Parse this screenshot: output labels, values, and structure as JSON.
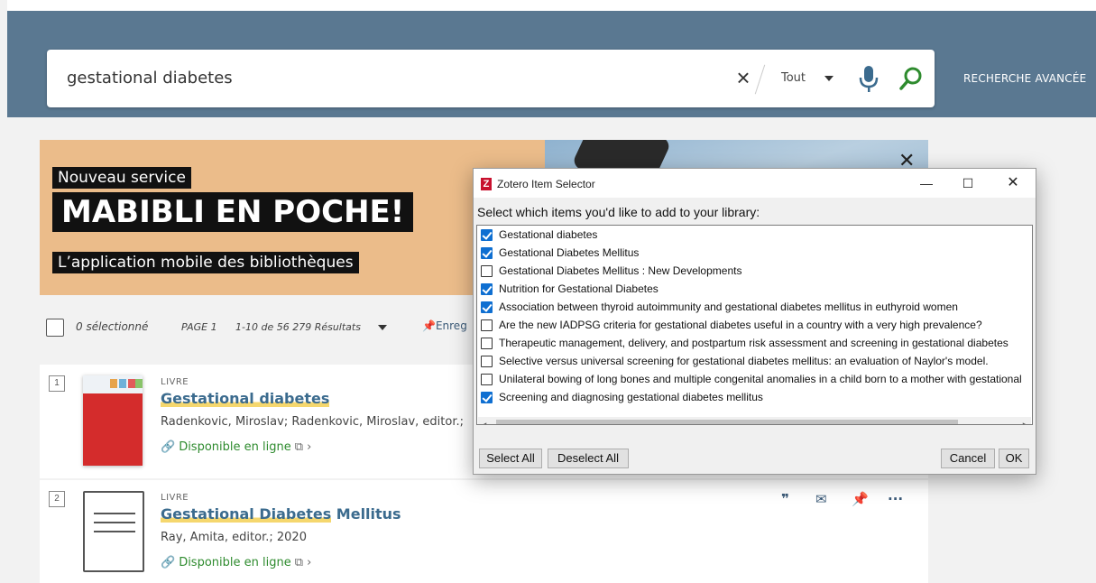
{
  "search": {
    "query": "gestational diabetes",
    "scope": "Tout",
    "advanced_label": "RECHERCHE AVANCÉE"
  },
  "promo": {
    "tag": "Nouveau service",
    "title": "MABIBLI EN POCHE!",
    "subtitle": "L’application mobile des bibliothèques"
  },
  "toolbar": {
    "selected": "0 sélectionné",
    "page": "PAGE 1",
    "count": "1-10 de 56 279 Résultats",
    "save_label": "Enreg"
  },
  "results": [
    {
      "number": "1",
      "type": "LIVRE",
      "title_highlight": "Gestational diabetes",
      "title_rest": "",
      "author": "Radenkovic, Miroslav; Radenkovic, Miroslav, editor.;",
      "availability": "Disponible en ligne"
    },
    {
      "number": "2",
      "type": "LIVRE",
      "title_highlight": "Gestational Diabetes",
      "title_rest": " Mellitus",
      "author": "Ray, Amita, editor.; 2020",
      "availability": "Disponible en ligne"
    }
  ],
  "dialog": {
    "title": "Zotero Item Selector",
    "logo_letter": "Z",
    "prompt": "Select which items you'd like to add to your library:",
    "items": [
      {
        "label": "Gestational diabetes",
        "checked": true
      },
      {
        "label": "Gestational Diabetes Mellitus",
        "checked": true
      },
      {
        "label": "Gestational Diabetes Mellitus : New Developments",
        "checked": false
      },
      {
        "label": "Nutrition for Gestational Diabetes",
        "checked": true
      },
      {
        "label": "Association between thyroid autoimmunity and gestational diabetes mellitus in euthyroid women",
        "checked": true
      },
      {
        "label": "Are the new IADPSG criteria for gestational diabetes useful in a country with a very high prevalence?",
        "checked": false
      },
      {
        "label": "Therapeutic management, delivery, and postpartum risk assessment and screening in gestational diabetes",
        "checked": false
      },
      {
        "label": "Selective versus universal screening for gestational diabetes mellitus: an evaluation of Naylor's model.",
        "checked": false
      },
      {
        "label": "Unilateral bowing of long bones and multiple congenital anomalies in a child born to a mother with gestational",
        "checked": false
      },
      {
        "label": "Screening and diagnosing gestational diabetes mellitus",
        "checked": true
      }
    ],
    "buttons": {
      "select_all": "Select All",
      "deselect_all": "Deselect All",
      "cancel": "Cancel",
      "ok": "OK"
    }
  },
  "colors": {
    "header": "#5a7891",
    "promo": "#ebbc8a",
    "link": "#3b6b8e",
    "available": "#2e8b2e",
    "checkbox": "#0f6fd1"
  }
}
